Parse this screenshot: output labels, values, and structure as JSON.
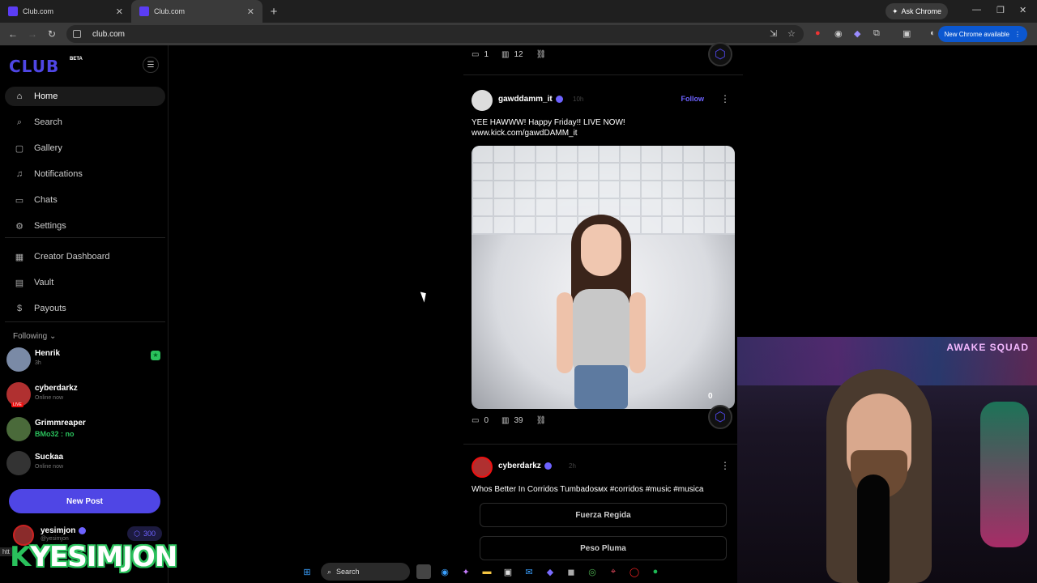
{
  "browser": {
    "tabs": [
      {
        "title": "Club.com",
        "active": false
      },
      {
        "title": "Club.com",
        "active": true
      }
    ],
    "ask_chrome": "Ask Chrome",
    "url": "club.com",
    "new_chrome": "New Chrome available",
    "status_url": "htt"
  },
  "sidebar": {
    "logo": "CLUB",
    "beta": "BETA",
    "menu": [
      {
        "label": "Home",
        "icon": "home-icon",
        "active": true
      },
      {
        "label": "Search",
        "icon": "search-icon"
      },
      {
        "label": "Gallery",
        "icon": "gallery-icon"
      },
      {
        "label": "Notifications",
        "icon": "bell-icon"
      },
      {
        "label": "Chats",
        "icon": "chat-icon"
      },
      {
        "label": "Settings",
        "icon": "gear-icon"
      },
      {
        "label": "Creator Dashboard",
        "icon": "dashboard-icon"
      },
      {
        "label": "Vault",
        "icon": "vault-icon"
      },
      {
        "label": "Payouts",
        "icon": "dollar-icon"
      }
    ],
    "following_label": "Following",
    "following": [
      {
        "name": "Henrik",
        "status": "3h",
        "badge": "star"
      },
      {
        "name": "cyberdarkz",
        "status": "Online now",
        "live": "LIVE"
      },
      {
        "name": "Grimmreaper",
        "status": "BMo32 : no"
      },
      {
        "name": "Suckaa",
        "status": "Online now"
      }
    ],
    "new_post": "New Post",
    "me": {
      "name": "yesimjon",
      "handle": "@yesimjon",
      "coins": "300"
    }
  },
  "feed": {
    "prev_post": {
      "comments": "1",
      "views": "12"
    },
    "post1": {
      "username": "gawddamm_it",
      "time": "10h",
      "follow": "Follow",
      "text_line1": "YEE HAWWW! Happy Friday!! LIVE NOW!",
      "text_line2": "www.kick.com/gawdDAMM_it",
      "media_count": "0",
      "comments": "0",
      "views": "39"
    },
    "post2": {
      "username": "cyberdarkz",
      "time": "2h",
      "live": "LIVE",
      "text": "Whos Better In Corridos Tumbadosмх #corridos #music #musica",
      "poll_options": [
        "Fuerza Regida",
        "Peso Pluma"
      ]
    }
  },
  "overlay": {
    "name": "YESIMJON",
    "k": "K"
  },
  "webcam": {
    "sign": "AWAKE SQUAD"
  },
  "taskbar": {
    "search": "Search"
  }
}
